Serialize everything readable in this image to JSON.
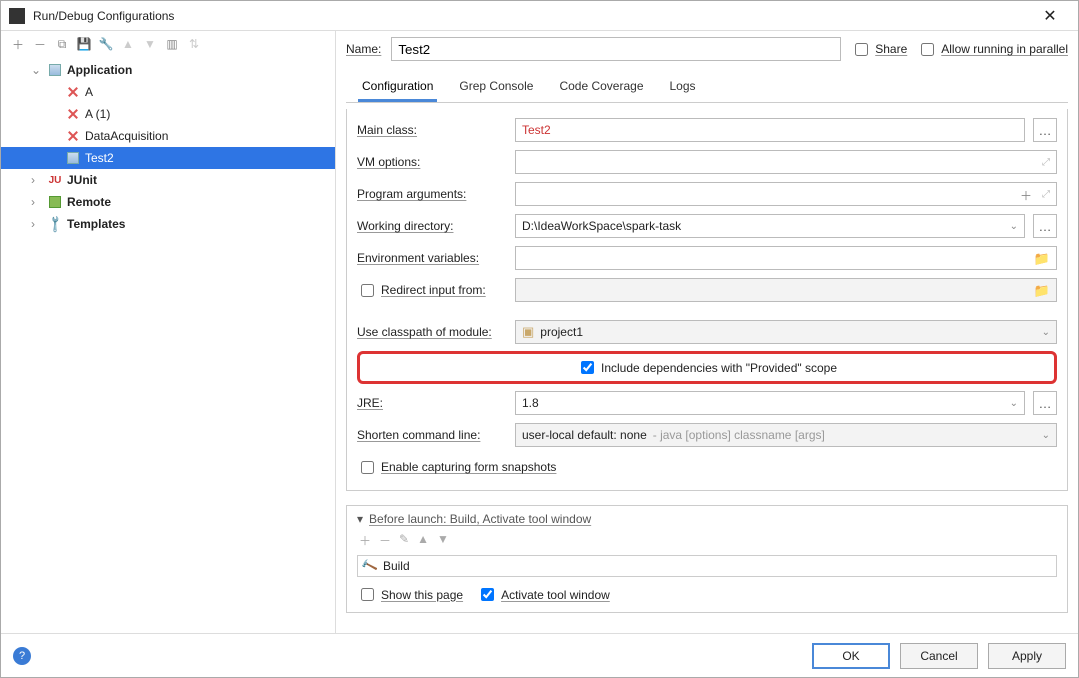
{
  "window": {
    "title": "Run/Debug Configurations"
  },
  "tree": {
    "application": {
      "label": "Application",
      "children": {
        "a": {
          "label": "A"
        },
        "a1": {
          "label": "A (1)"
        },
        "da": {
          "label": "DataAcquisition"
        },
        "t2": {
          "label": "Test2"
        }
      }
    },
    "junit": {
      "label": "JUnit"
    },
    "remote": {
      "label": "Remote"
    },
    "templates": {
      "label": "Templates"
    }
  },
  "nameRow": {
    "label": "Name:",
    "value": "Test2",
    "share": "Share",
    "parallel": "Allow running in parallel"
  },
  "tabs": {
    "config": "Configuration",
    "grep": "Grep Console",
    "cov": "Code Coverage",
    "logs": "Logs"
  },
  "form": {
    "mainClass": {
      "label": "Main class:",
      "value": "Test2"
    },
    "vmOptions": {
      "label": "VM options:"
    },
    "progArgs": {
      "label": "Program arguments:"
    },
    "workDir": {
      "label": "Working directory:",
      "value": "D:\\IdeaWorkSpace\\spark-task"
    },
    "envVars": {
      "label": "Environment variables:"
    },
    "redirect": {
      "label": "Redirect input from:"
    },
    "classpath": {
      "label": "Use classpath of module:",
      "value": "project1"
    },
    "includeDeps": {
      "label": "Include dependencies with \"Provided\" scope"
    },
    "jre": {
      "label": "JRE:",
      "value": "1.8"
    },
    "shorten": {
      "label": "Shorten command line:",
      "value": "user-local default: none",
      "hint": " - java [options] classname [args]"
    },
    "snapshots": {
      "label": "Enable capturing form snapshots"
    }
  },
  "beforeLaunch": {
    "title": "Before launch: Build, Activate tool window",
    "build": "Build",
    "showPage": "Show this page",
    "activate": "Activate tool window"
  },
  "buttons": {
    "ok": "OK",
    "cancel": "Cancel",
    "apply": "Apply"
  }
}
